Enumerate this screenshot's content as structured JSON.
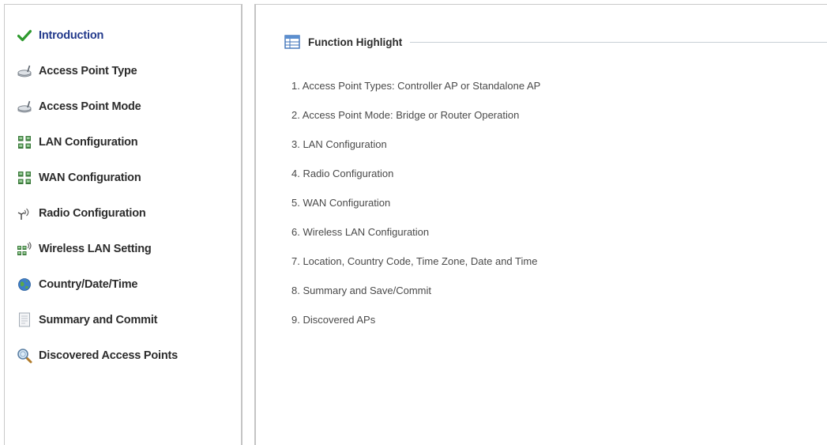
{
  "sidebar": {
    "items": [
      {
        "label": "Introduction",
        "icon": "check-icon",
        "active": true
      },
      {
        "label": "Access Point Type",
        "icon": "access-point-icon",
        "active": false
      },
      {
        "label": "Access Point Mode",
        "icon": "access-point-icon",
        "active": false
      },
      {
        "label": "LAN Configuration",
        "icon": "network-icon",
        "active": false
      },
      {
        "label": "WAN Configuration",
        "icon": "network-icon",
        "active": false
      },
      {
        "label": "Radio Configuration",
        "icon": "radio-antenna-icon",
        "active": false
      },
      {
        "label": "Wireless LAN Setting",
        "icon": "wireless-network-icon",
        "active": false
      },
      {
        "label": "Country/Date/Time",
        "icon": "globe-icon",
        "active": false
      },
      {
        "label": "Summary and Commit",
        "icon": "document-icon",
        "active": false
      },
      {
        "label": "Discovered Access Points",
        "icon": "magnifier-icon",
        "active": false
      }
    ]
  },
  "main": {
    "section_title": "Function Highlight",
    "section_icon": "table-icon",
    "highlights": [
      "1. Access Point Types: Controller AP or Standalone AP",
      "2. Access Point Mode: Bridge or Router Operation",
      "3. LAN Configuration",
      "4. Radio Configuration",
      "5. WAN Configuration",
      "6. Wireless LAN Configuration",
      "7. Location, Country Code, Time Zone, Date and Time",
      "8. Summary and Save/Commit",
      "9. Discovered APs"
    ]
  },
  "colors": {
    "active_label": "#233a8c",
    "label": "#2c2c2c",
    "body_text": "#4a4a4a",
    "check": "#2e9a2e",
    "border": "#c4c4c4"
  }
}
